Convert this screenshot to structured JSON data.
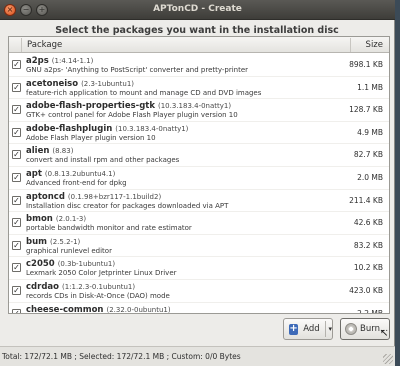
{
  "window": {
    "title": "APTonCD - Create",
    "close_glyph": "×",
    "min_glyph": "−",
    "max_glyph": "+"
  },
  "heading": "Select the packages you want in the installation disc",
  "table": {
    "columns": [
      "Package",
      "Size"
    ],
    "rows": [
      {
        "checked": true,
        "name": "a2ps",
        "version": "(1:4.14-1.1)",
        "description": "GNU a2ps- 'Anything to PostScript' converter and pretty-printer",
        "size": "898.1 KB"
      },
      {
        "checked": true,
        "name": "acetoneiso",
        "version": "(2.3-1ubuntu1)",
        "description": "feature-rich application to mount and manage CD and DVD images",
        "size": "1.1 MB"
      },
      {
        "checked": true,
        "name": "adobe-flash-properties-gtk",
        "version": "(10.3.183.4-0natty1)",
        "description": "GTK+ control panel for Adobe Flash Player plugin version 10",
        "size": "128.7 KB"
      },
      {
        "checked": true,
        "name": "adobe-flashplugin",
        "version": "(10.3.183.4-0natty1)",
        "description": "Adobe Flash Player plugin version 10",
        "size": "4.9 MB"
      },
      {
        "checked": true,
        "name": "alien",
        "version": "(8.83)",
        "description": "convert and install rpm and other packages",
        "size": "82.7 KB"
      },
      {
        "checked": true,
        "name": "apt",
        "version": "(0.8.13.2ubuntu4.1)",
        "description": "Advanced front-end for dpkg",
        "size": "2.0 MB"
      },
      {
        "checked": true,
        "name": "aptoncd",
        "version": "(0.1.98+bzr117-1.1build2)",
        "description": "Installation disc creator for packages downloaded via APT",
        "size": "211.4 KB"
      },
      {
        "checked": true,
        "name": "bmon",
        "version": "(2.0.1-3)",
        "description": "portable bandwidth monitor and rate estimator",
        "size": "42.6 KB"
      },
      {
        "checked": true,
        "name": "bum",
        "version": "(2.5.2-1)",
        "description": "graphical runlevel editor",
        "size": "83.2 KB"
      },
      {
        "checked": true,
        "name": "c2050",
        "version": "(0.3b-1ubuntu1)",
        "description": "Lexmark 2050 Color Jetprinter Linux Driver",
        "size": "10.2 KB"
      },
      {
        "checked": true,
        "name": "cdrdao",
        "version": "(1:1.2.3-0.1ubuntu1)",
        "description": "records CDs in Disk-At-Once (DAO) mode",
        "size": "423.0 KB"
      },
      {
        "checked": true,
        "name": "cheese-common",
        "version": "(2.32.0-0ubuntu1)",
        "description": "Common files for the Cheese tool to take pictures and videos",
        "size": "2.2 MB"
      }
    ]
  },
  "buttons": {
    "add_label": "Add",
    "add_icon_glyph": "+",
    "add_arrow_glyph": "▾",
    "burn_label": "Burn..."
  },
  "cursor_glyph": "↖",
  "status": "Total: 172/72.1 MB ; Selected: 172/72.1 MB ; Custom: 0/0 Bytes",
  "colors": {
    "titlebar": "#3e3d39",
    "window_bg": "#edece9",
    "add_icon": "#3d6ab8",
    "close_button": "#d9501c"
  },
  "icons": [
    "close-icon",
    "minimize-icon",
    "maximize-icon",
    "add-icon",
    "dropdown-arrow-icon",
    "disc-icon",
    "mouse-cursor-icon",
    "resize-grip-icon"
  ]
}
